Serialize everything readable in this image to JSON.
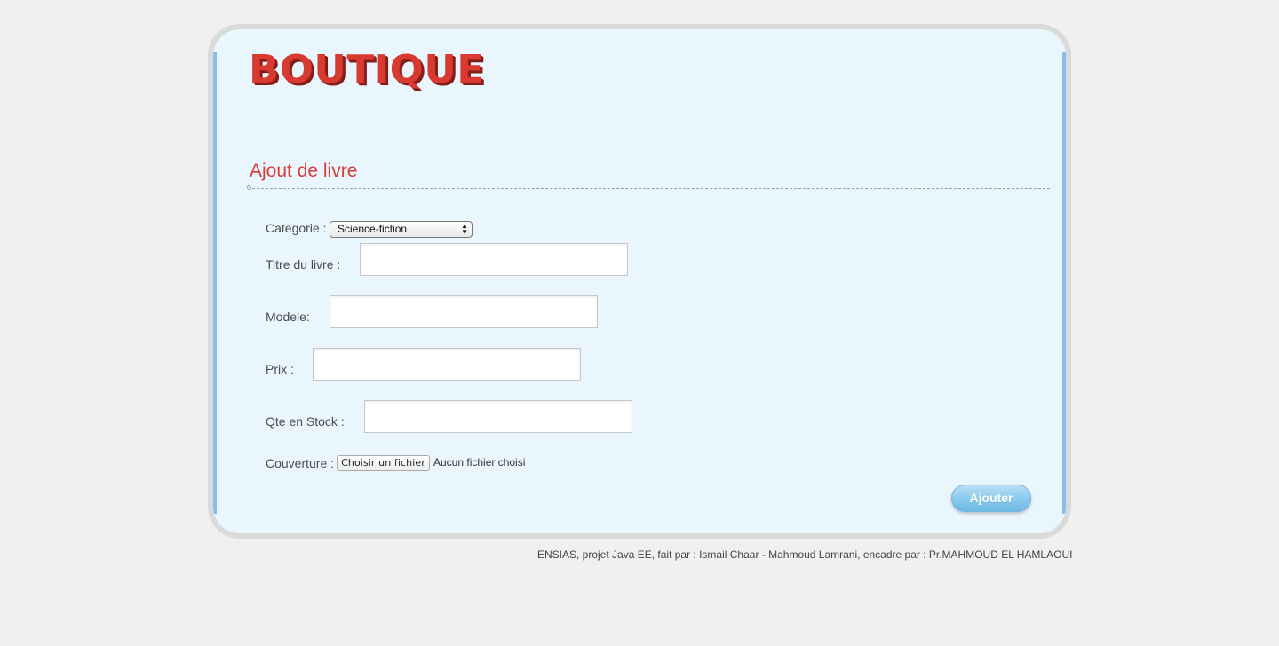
{
  "app": {
    "logo_text": "BOUTIQUE",
    "colors": {
      "page_background": "#f0f0f0",
      "card_background": "#eaf6fd",
      "card_border": "#d9dada",
      "accent_blue": "#86bde9",
      "logo_red": "#d83a32",
      "title_red": "#d93b38",
      "button_blue": "#8ccbee"
    }
  },
  "page": {
    "title": "Ajout de livre"
  },
  "form": {
    "category": {
      "label": "Categorie :",
      "selected": "Science-fiction",
      "arrow_icon": "up-down-arrow-icon"
    },
    "title": {
      "label": "Titre du livre :",
      "value": ""
    },
    "model": {
      "label": "Modele:",
      "value": ""
    },
    "price": {
      "label": "Prix :",
      "value": ""
    },
    "stock": {
      "label": "Qte en Stock :",
      "value": ""
    },
    "cover": {
      "label": "Couverture :",
      "button_label": "Choisir un fichier",
      "status": "Aucun fichier choisi"
    },
    "submit_label": "Ajouter"
  },
  "footer": {
    "text": "ENSIAS, projet Java EE, fait par : Ismail Chaar - Mahmoud Lamrani, encadre par : Pr.MAHMOUD EL HAMLAOUI"
  }
}
